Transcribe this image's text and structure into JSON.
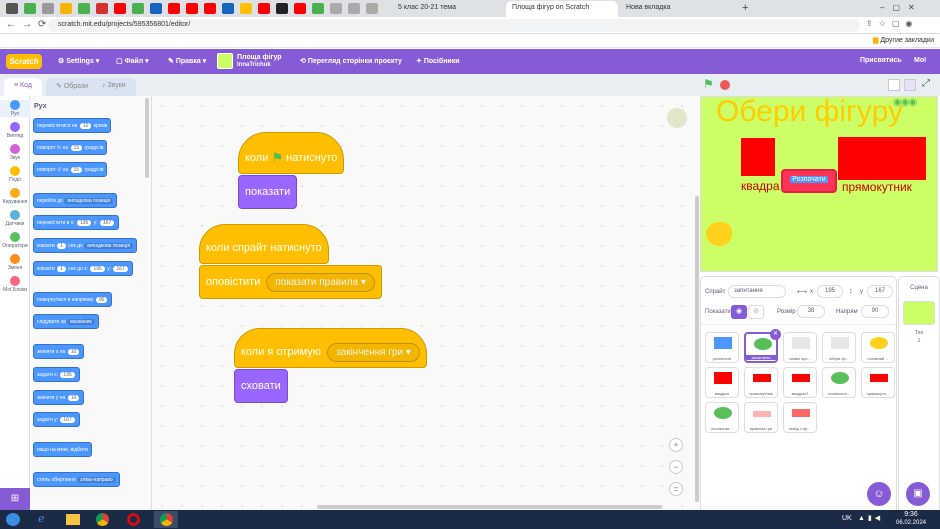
{
  "browser": {
    "tabs": [
      {
        "label": "5 клас 20-21 тема"
      },
      {
        "label": "Площа фігур on Scratch"
      },
      {
        "label": "Нова вкладка"
      }
    ],
    "url": "scratch.mit.edu/projects/595356801/editor/",
    "other_bookmarks": "Другие закладки"
  },
  "menu": {
    "logo": "Scratch",
    "settings": "Settings",
    "file": "Файл",
    "edit": "Правка",
    "project_title": "Площа фігур",
    "author": "InnaTrichuk",
    "see_project_page": "Перегляд сторінки проєкту",
    "tutorials": "Посібники",
    "share": "Присвятись",
    "folder": "Мої"
  },
  "editor_tabs": {
    "code": "Код",
    "costumes": "Образи",
    "sounds": "Звуки"
  },
  "categories": [
    {
      "label": "Рух",
      "color": "#4c97ff"
    },
    {
      "label": "Вигляд",
      "color": "#9966ff"
    },
    {
      "label": "Звук",
      "color": "#cf63cf"
    },
    {
      "label": "Події",
      "color": "#ffbf00"
    },
    {
      "label": "Керування",
      "color": "#ffab19"
    },
    {
      "label": "Датчики",
      "color": "#5cb1d6"
    },
    {
      "label": "Оператори",
      "color": "#59c059"
    },
    {
      "label": "Змінні",
      "color": "#ff8c1a"
    },
    {
      "label": "Мої Блоки",
      "color": "#ff6680"
    }
  ],
  "palette": {
    "heading": "Рух",
    "blocks": [
      {
        "pre": "переміститися на",
        "v": "10",
        "post": "кроків"
      },
      {
        "pre": "поворот ↻ на",
        "v": "15",
        "post": "градусів"
      },
      {
        "pre": "поворот ↺ на",
        "v": "15",
        "post": "градусів"
      },
      {
        "pre": "перейти до",
        "dd": "випадкова позиція"
      },
      {
        "pre": "перемістити в x:",
        "v": "195",
        "mid": "y:",
        "v2": "167"
      },
      {
        "pre": "ковзати",
        "v": "1",
        "mid": "сек до",
        "dd": "випадкова позиція"
      },
      {
        "pre": "ковзати",
        "v": "1",
        "mid": "сек до x:",
        "v2": "195",
        "mid2": "y:",
        "v3": "167"
      },
      {
        "pre": "повернутися в напрямку",
        "v": "90"
      },
      {
        "pre": "слідувати за",
        "dd": "вказівник"
      },
      {
        "pre": "змінити x на",
        "v": "10"
      },
      {
        "pre": "задати x:",
        "v": "195"
      },
      {
        "pre": "змінити y на",
        "v": "10"
      },
      {
        "pre": "задати y:",
        "v": "167"
      },
      {
        "pre": "якщо на межі, відбити"
      },
      {
        "pre": "стиль обертання",
        "dd": "зліва-направо"
      }
    ]
  },
  "scripts": {
    "s1_hat": "коли",
    "s1_hat_post": "натиснуто",
    "s1_block": "показати",
    "s2_hat": "коли спрайт натиснуто",
    "s2_block": "оповістити",
    "s2_msg": "показати правила",
    "s3_hat": "коли я отримую",
    "s3_msg": "закінчення гри",
    "s3_block": "сховати"
  },
  "stage": {
    "title": "Обери фігуру",
    "label_square": "квадра",
    "label_rect": "прямокутник",
    "center_button": "Розпочати"
  },
  "sprite_info": {
    "sprite_label": "Спрайт",
    "sprite_name": "запитання",
    "x_label": "x",
    "x": "195",
    "y_label": "y",
    "y": "167",
    "show_label": "Показати",
    "size_label": "Розмір",
    "size": "38",
    "direction_label": "Напрям",
    "direction": "90"
  },
  "sprites": [
    {
      "name": "розпочати",
      "thumb": "#4c97ff"
    },
    {
      "name": "запитання",
      "thumb": "#59c059"
    },
    {
      "name": "назва про...",
      "thumb": "#e6e6e6"
    },
    {
      "name": "обери фі...",
      "thumb": "#e6e6e6"
    },
    {
      "name": "головний ...",
      "thumb": "#ffd11a"
    },
    {
      "name": "квадрат",
      "thumb": "#ff0000"
    },
    {
      "name": "прямокутник",
      "thumb": "#ff0000"
    },
    {
      "name": "квадрат2",
      "thumb": "#ff0000"
    },
    {
      "name": "похвала в...",
      "thumb": "#59c059"
    },
    {
      "name": "прямокутн...",
      "thumb": "#ff0000"
    },
    {
      "name": "кнопка ви...",
      "thumb": "#59c059"
    },
    {
      "name": "правила гри",
      "thumb": "#ffb3b3"
    },
    {
      "name": "вихід з пр...",
      "thumb": "#ff6666"
    }
  ],
  "stage_panel": {
    "label": "Сцена",
    "backdrops_label": "Тло",
    "backdrops_count": "1"
  },
  "taskbar": {
    "lang": "UK",
    "time": "9:36",
    "date": "06.02.2024"
  }
}
